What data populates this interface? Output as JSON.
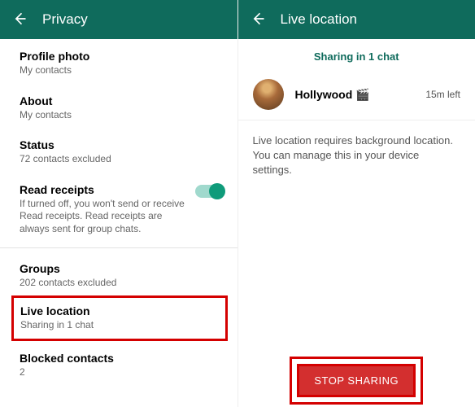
{
  "left": {
    "header": "Privacy",
    "profile_photo": {
      "label": "Profile photo",
      "sub": "My contacts"
    },
    "about": {
      "label": "About",
      "sub": "My contacts"
    },
    "status": {
      "label": "Status",
      "sub": "72 contacts excluded"
    },
    "read_receipts": {
      "label": "Read receipts",
      "sub": "If turned off, you won't send or receive Read receipts. Read receipts are always sent for group chats."
    },
    "groups": {
      "label": "Groups",
      "sub": "202 contacts excluded"
    },
    "live_location": {
      "label": "Live location",
      "sub": "Sharing in 1 chat"
    },
    "blocked": {
      "label": "Blocked contacts",
      "sub": "2"
    }
  },
  "right": {
    "header": "Live location",
    "sharing_line": "Sharing in 1 chat",
    "chat": {
      "name": "Hollywood 🎬",
      "time": "15m left"
    },
    "info": "Live location requires background location. You can manage this in your device settings.",
    "stop_button": "STOP SHARING"
  }
}
